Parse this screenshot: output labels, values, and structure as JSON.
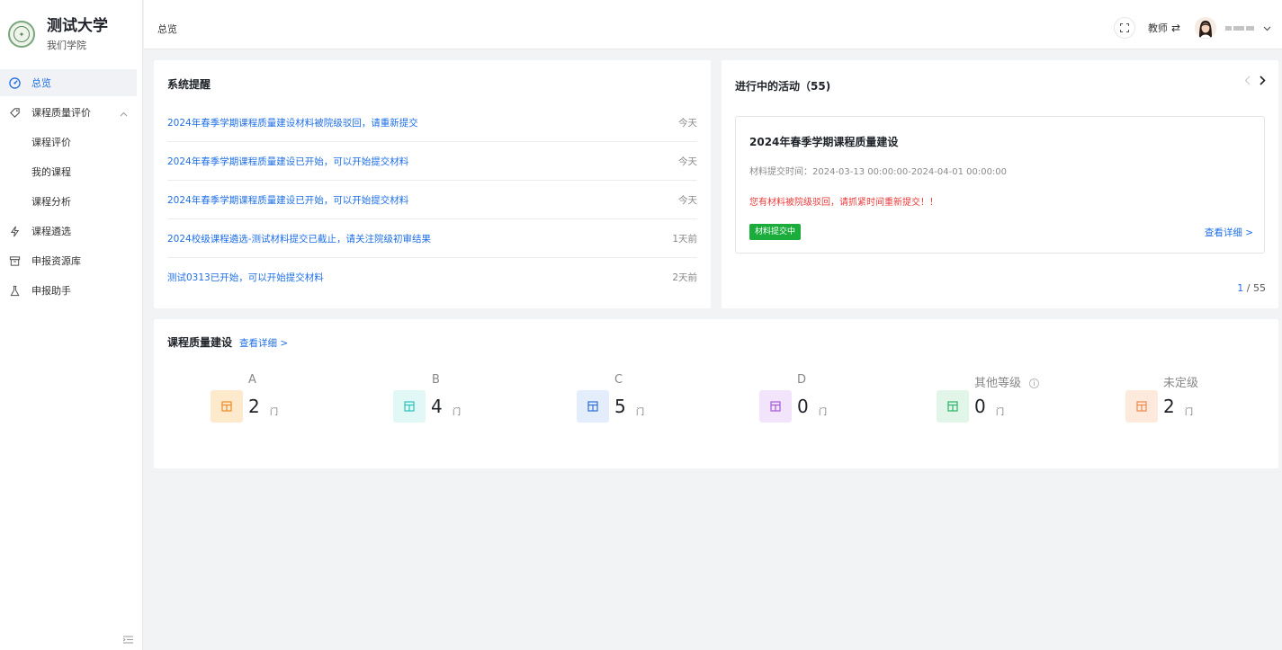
{
  "brand": {
    "title": "测试大学",
    "subtitle": "我们学院",
    "logo_text": "测试大学"
  },
  "sidebar": {
    "items": [
      {
        "label": "总览",
        "icon": "dashboard-icon",
        "active": true
      },
      {
        "label": "课程质量评价",
        "icon": "tag-icon",
        "expanded": true
      },
      {
        "label": "课程评价",
        "sub": true
      },
      {
        "label": "我的课程",
        "sub": true
      },
      {
        "label": "课程分析",
        "sub": true
      },
      {
        "label": "课程遴选",
        "icon": "spark-icon"
      },
      {
        "label": "申报资源库",
        "icon": "archive-icon"
      },
      {
        "label": "申报助手",
        "icon": "flask-icon"
      }
    ]
  },
  "header": {
    "breadcrumb": "总览",
    "role": "教师",
    "switch_symbol": "⇄"
  },
  "system_notice": {
    "title": "系统提醒",
    "items": [
      {
        "text": "2024年春季学期课程质量建设材料被院级驳回，请重新提交",
        "time": "今天"
      },
      {
        "text": "2024年春季学期课程质量建设已开始，可以开始提交材料",
        "time": "今天"
      },
      {
        "text": "2024年春季学期课程质量建设已开始，可以开始提交材料",
        "time": "今天"
      },
      {
        "text": "2024校级课程遴选-测试材料提交已截止，请关注院级初审结果",
        "time": "1天前"
      },
      {
        "text": "测试0313已开始，可以开始提交材料",
        "time": "2天前"
      }
    ]
  },
  "activity": {
    "title": "进行中的活动（55)",
    "card": {
      "title": "2024年春季学期课程质量建设",
      "time": "材料提交时间：2024-03-13 00:00:00-2024-04-01 00:00:00",
      "warning": "您有材料被院级驳回，请抓紧时间重新提交！！",
      "badge": "材料提交中",
      "link": "查看详细 >"
    },
    "pager": {
      "current": "1",
      "rest": " / 55"
    }
  },
  "quality": {
    "title": "课程质量建设",
    "link": "查看详细 >",
    "grades": [
      {
        "label": "A",
        "value": "2",
        "unit": "门",
        "color": "#f5a623",
        "bg": "#fde9cc"
      },
      {
        "label": "B",
        "value": "4",
        "unit": "门",
        "color": "#2bc4b8",
        "bg": "#e2f8f6"
      },
      {
        "label": "C",
        "value": "5",
        "unit": "门",
        "color": "#2f6fd8",
        "bg": "#e3edfc"
      },
      {
        "label": "D",
        "value": "0",
        "unit": "门",
        "color": "#a45ad8",
        "bg": "#f1e4fb"
      },
      {
        "label": "其他等级",
        "value": "0",
        "unit": "门",
        "color": "#2bb36a",
        "bg": "#e1f5e9"
      },
      {
        "label": "未定级",
        "value": "2",
        "unit": "门",
        "color": "#ef8a4a",
        "bg": "#fdeadd"
      }
    ]
  }
}
